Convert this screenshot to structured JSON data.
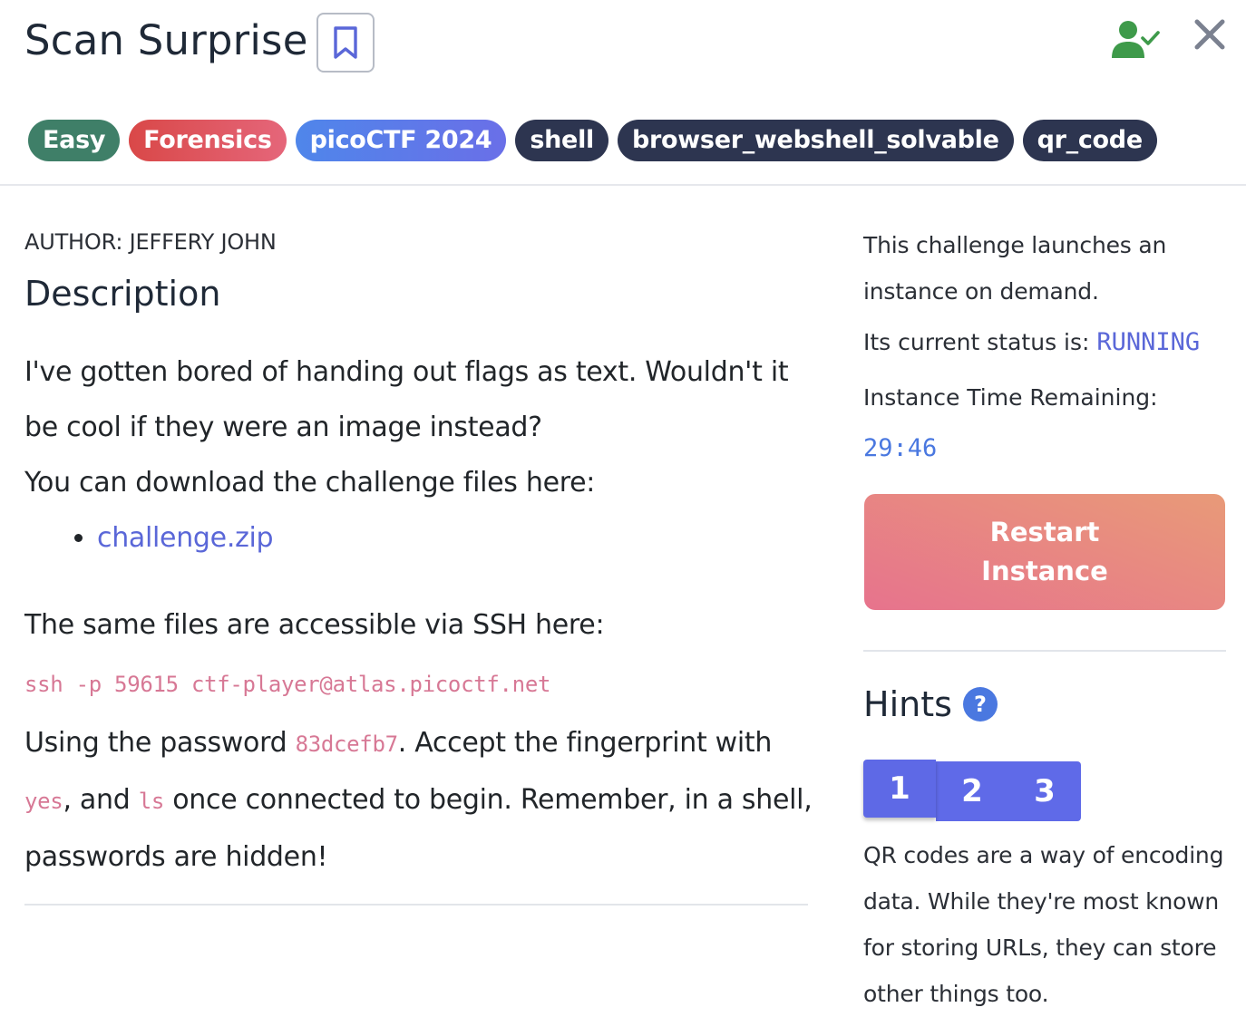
{
  "header": {
    "title": "Scan Surprise",
    "icons": {
      "bookmark": "bookmark-icon",
      "user": "user-check-icon",
      "close": "close-icon"
    }
  },
  "tags": [
    {
      "label": "Easy",
      "color": "#3f7f68"
    },
    {
      "label": "Forensics",
      "color": "#d94a4a"
    },
    {
      "label": "picoCTF 2024",
      "color": "#5b74ea"
    },
    {
      "label": "shell",
      "color": "#2d3550"
    },
    {
      "label": "browser_webshell_solvable",
      "color": "#2d3550"
    },
    {
      "label": "qr_code",
      "color": "#2d3550"
    }
  ],
  "main": {
    "author": "AUTHOR: JEFFERY JOHN",
    "heading": "Description",
    "intro": "I've gotten bored of handing out flags as text. Wouldn't it be cool if they were an image instead?",
    "download_text": "You can download the challenge files here:",
    "download_link": "challenge.zip",
    "ssh_text": "The same files are accessible via SSH here:",
    "ssh_command": "ssh -p 59615 ctf-player@atlas.picoctf.net",
    "pw_prefix": "Using the password ",
    "password": "83dcefb7",
    "pw_mid": ". Accept the fingerprint with ",
    "yes": "yes",
    "pw_and": ", and ",
    "ls": "ls",
    "pw_end": " once connected to begin. Remember, in a shell, passwords are hidden!"
  },
  "sidebar": {
    "instance_text": "This challenge launches an instance on demand.",
    "status_label": "Its current status is: ",
    "status_value": "RUNNING",
    "time_label": "Instance Time Remaining:",
    "time_value": "29:46",
    "restart_line1": "Restart",
    "restart_line2": "Instance"
  },
  "hints": {
    "heading": "Hints",
    "help_symbol": "?",
    "tabs": [
      "1",
      "2",
      "3"
    ],
    "active_tab": "1",
    "text": "QR codes are a way of encoding data. While they're most known for storing URLs, they can store other things too."
  },
  "colors": {
    "link": "#5a67d8",
    "code": "#d77895",
    "status": "#5a67d8",
    "user_icon": "#3e9a4a"
  }
}
